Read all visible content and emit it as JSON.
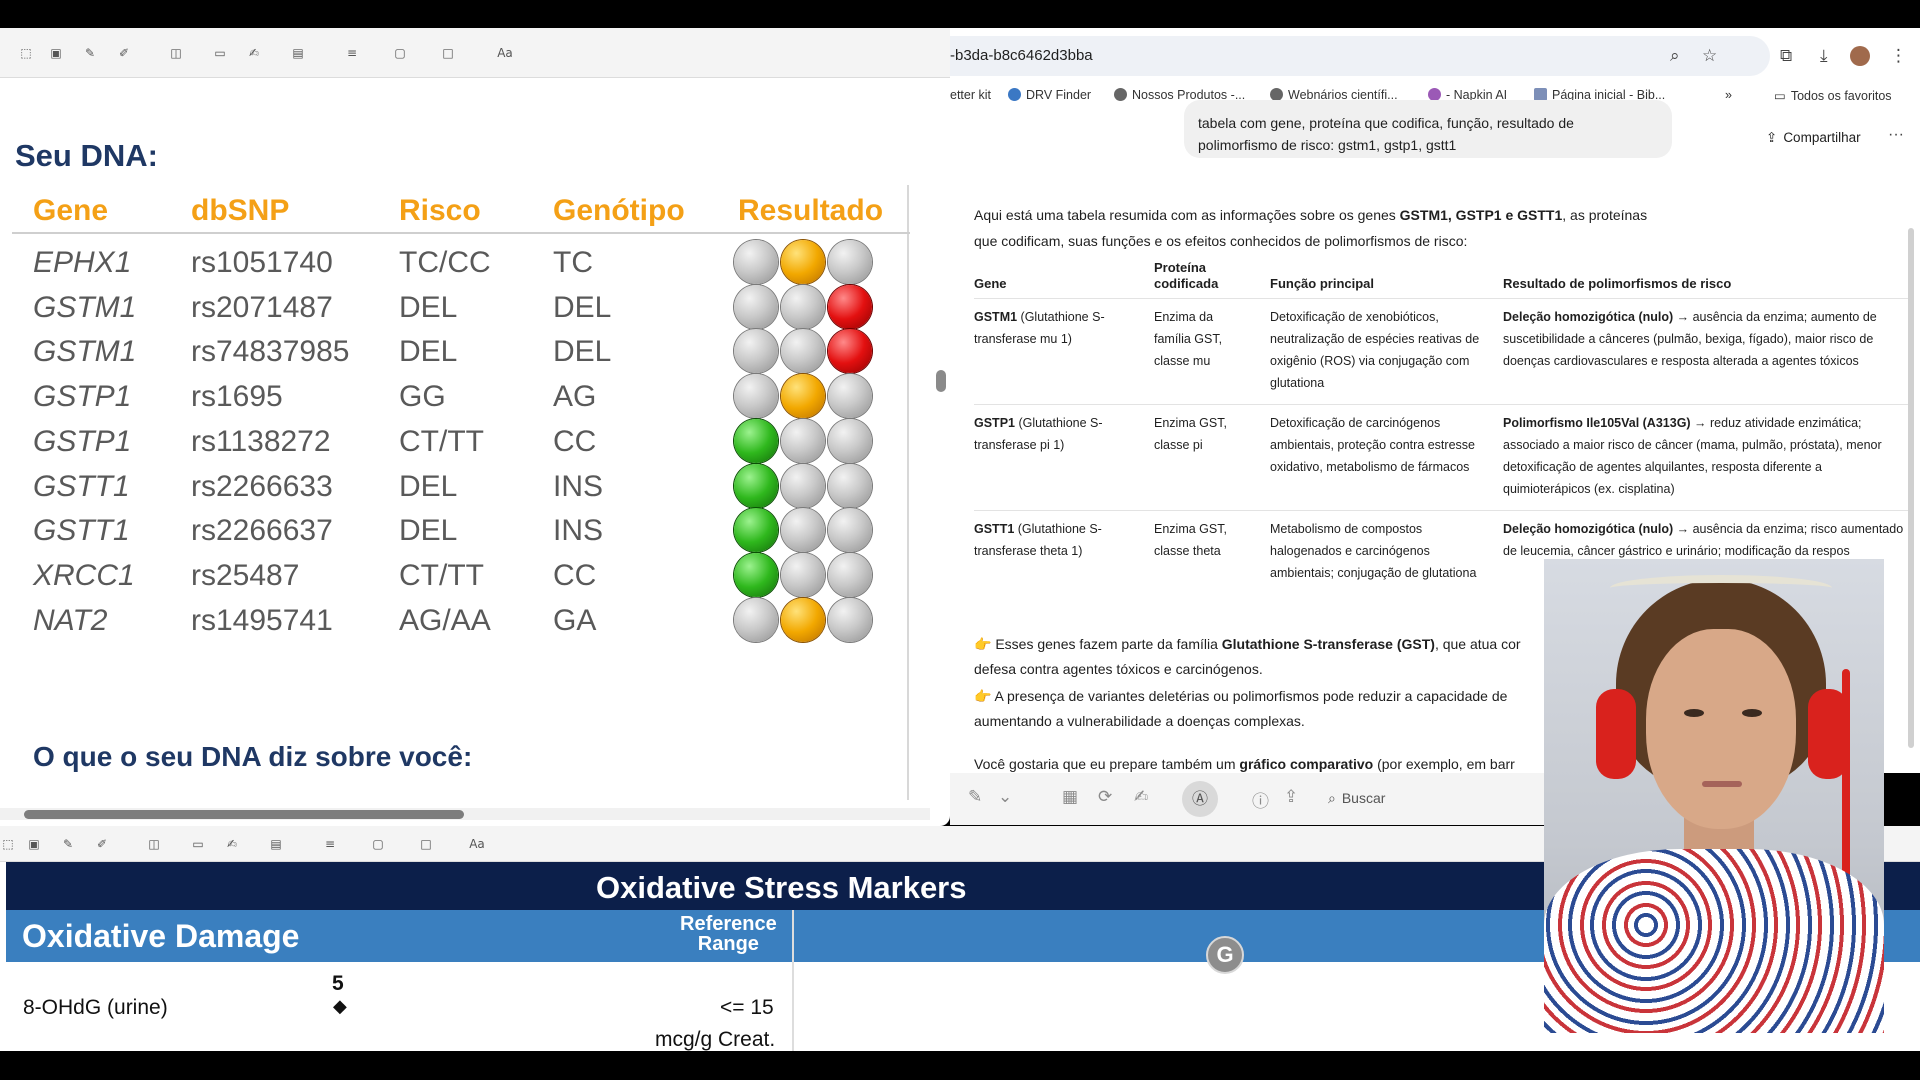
{
  "preview": {
    "toolbar_faded_text": "",
    "slide_title": "Seu DNA:",
    "headers": [
      "Gene",
      "dbSNP",
      "Risco",
      "Genótipo",
      "Resultado"
    ],
    "rows": [
      {
        "gene": "EPHX1",
        "snp": "rs1051740",
        "risco": "TC/CC",
        "genotipo": "TC",
        "lights": [
          "grey",
          "amber",
          "grey"
        ]
      },
      {
        "gene": "GSTM1",
        "snp": "rs2071487",
        "risco": "DEL",
        "genotipo": "DEL",
        "lights": [
          "grey",
          "grey",
          "red"
        ]
      },
      {
        "gene": "GSTM1",
        "snp": "rs74837985",
        "risco": "DEL",
        "genotipo": "DEL",
        "lights": [
          "grey",
          "grey",
          "red"
        ]
      },
      {
        "gene": "GSTP1",
        "snp": "rs1695",
        "risco": "GG",
        "genotipo": "AG",
        "lights": [
          "grey",
          "amber",
          "grey"
        ]
      },
      {
        "gene": "GSTP1",
        "snp": "rs1138272",
        "risco": "CT/TT",
        "genotipo": "CC",
        "lights": [
          "green",
          "grey",
          "grey"
        ]
      },
      {
        "gene": "GSTT1",
        "snp": "rs2266633",
        "risco": "DEL",
        "genotipo": "INS",
        "lights": [
          "green",
          "grey",
          "grey"
        ]
      },
      {
        "gene": "GSTT1",
        "snp": "rs2266637",
        "risco": "DEL",
        "genotipo": "INS",
        "lights": [
          "green",
          "grey",
          "grey"
        ]
      },
      {
        "gene": "XRCC1",
        "snp": "rs25487",
        "risco": "CT/TT",
        "genotipo": "CC",
        "lights": [
          "green",
          "grey",
          "grey"
        ]
      },
      {
        "gene": "NAT2",
        "snp": "rs1495741",
        "risco": "AG/AA",
        "genotipo": "GA",
        "lights": [
          "grey",
          "amber",
          "grey"
        ]
      }
    ],
    "subtitle": "O que o seu DNA diz sobre você:",
    "colors": {
      "title": "#1f3864",
      "header": "#f4a016",
      "cell": "#595959"
    }
  },
  "browser": {
    "url": "-b3da-b8c6462d3bba",
    "bookmarks": [
      "etter kit",
      "DRV Finder",
      "Nossos Produtos -...",
      "Webnários científi...",
      "- Napkin AI",
      "Página inicial - Bib...",
      "»",
      "Todos os favoritos"
    ],
    "user_message_line1": "tabela com gene, proteína que codifica, função, resultado de",
    "user_message_line2": "polimorfismo de risco: gstm1, gstp1, gstt1",
    "share_label": "Compartilhar",
    "more_label": "···",
    "intro_part1": "Aqui está uma tabela resumida com as informações sobre os genes ",
    "intro_bold": "GSTM1, GSTP1 e GSTT1",
    "intro_part2": ", as proteínas",
    "intro_line2": "que codificam, suas funções e os efeitos conhecidos de polimorfismos de risco:",
    "table_headers": [
      "Gene",
      "Proteína codificada",
      "Função principal",
      "Resultado de polimorfismos de risco"
    ],
    "table_rows": [
      {
        "gene_bold": "GSTM1",
        "gene_rest": " (Glutathione S-transferase mu 1)",
        "protein": "Enzima da família GST, classe mu",
        "function": "Detoxificação de xenobióticos, neutralização de espécies reativas de oxigênio (ROS) via conjugação com glutationa",
        "result_bold": "Deleção homozigótica (nulo)",
        "result_rest": " → ausência da enzima; aumento de suscetibilidade a cânceres (pulmão, bexiga, fígado), maior risco de doenças cardiovasculares e resposta alterada a agentes tóxicos"
      },
      {
        "gene_bold": "GSTP1",
        "gene_rest": " (Glutathione S-transferase pi 1)",
        "protein": "Enzima GST, classe pi",
        "function": "Detoxificação de carcinógenos ambientais, proteção contra estresse oxidativo, metabolismo de fármacos",
        "result_bold": "Polimorfismo Ile105Val (A313G)",
        "result_rest": " → reduz atividade enzimática; associado a maior risco de câncer (mama, pulmão, próstata), menor detoxificação de agentes alquilantes, resposta diferente a quimioterápicos (ex. cisplatina)"
      },
      {
        "gene_bold": "GSTT1",
        "gene_rest": " (Glutathione S-transferase theta 1)",
        "protein": "Enzima GST, classe theta",
        "function": "Metabolismo de compostos halogenados e carcinógenos ambientais; conjugação de glutationa",
        "result_bold": "Deleção homozigótica (nulo)",
        "result_rest": " → ausência da enzima; risco aumentado de leucemia, câncer gástrico e urinário; modificação da respos"
      }
    ],
    "note1_part1": "👉 Esses genes fazem parte da família ",
    "note1_bold": "Glutathione S-transferase (GST)",
    "note1_part2": ", que atua cor",
    "note1_line2": "defesa contra agentes tóxicos e carcinógenos.",
    "note2_line1": "👉 A presença de variantes deletérias ou polimorfismos pode reduzir a capacidade de",
    "note2_line2": "aumentando a vulnerabilidade a doenças complexas.",
    "follow_part1": "Você gostaria que eu prepare também um ",
    "follow_bold": "gráfico comparativo",
    "follow_part2": " (por exemplo, em barr"
  },
  "preview_controls": {
    "search_label": "Buscar"
  },
  "doc2": {
    "title": "Oxidative Stress Markers",
    "section": "Oxidative Damage",
    "reference_line1": "Reference",
    "reference_line2": "Range",
    "marker": "8-OHdG (urine)",
    "value": "5",
    "limit": "<= 15",
    "unit": "mcg/g Creat.",
    "colors": {
      "title_bar": "#0c1f4a",
      "section_bar": "#3a7fbf"
    }
  }
}
